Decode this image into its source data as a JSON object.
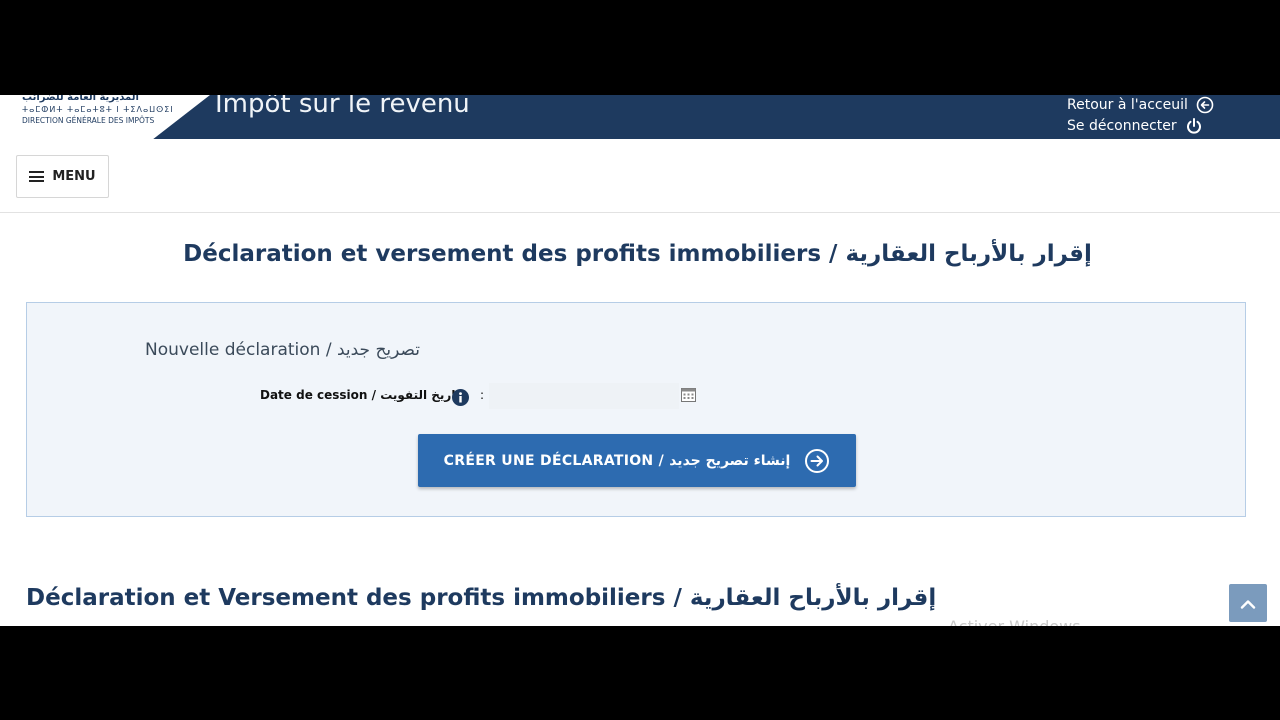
{
  "header": {
    "logo": {
      "arabic": "المديرية العامة للضرائب",
      "tifinagh": "ⵜⴰⵎⵀⵍⵜ ⵜⴰⵎⴰⵜⵓⵜ ⵏ ⵜⵉⴷⴰⵡⵙⵉⵏ",
      "french": "DIRECTION GÉNÉRALE DES IMPÔTS"
    },
    "app_title": "Impôt sur le revenu",
    "home_link": "Retour à l'acceuil",
    "logout_link": "Se déconnecter",
    "home_icon": "arrow-left-circle-icon",
    "logout_icon": "power-icon"
  },
  "menu": {
    "label": "MENU",
    "icon": "hamburger-icon"
  },
  "page_title": "Déclaration et versement des profits immobiliers / إقرار بالأرباح العقارية",
  "panel": {
    "heading": "Nouvelle déclaration / تصريح جديد",
    "date_label": "Date de cession / تاريخ التفويت",
    "info_icon": "info-icon",
    "colon": ":",
    "date_value": "",
    "calendar_icon": "calendar-icon",
    "create_button": "CRÉER UNE DÉCLARATION / إنشاء تصريح جديد",
    "create_icon": "arrow-right-circle-icon"
  },
  "section_title": "Déclaration et Versement des profits immobiliers / إقرار بالأرباح العقارية",
  "scroll_top_icon": "chevron-up-icon",
  "watermark": "Activer Windows",
  "colors": {
    "header_bg": "#1e3a5f",
    "title": "#1e3a5f",
    "button": "#2d6bb0",
    "panel_bg": "#f1f5fa",
    "panel_border": "#b6cde6",
    "scroll_top": "#7b9bbd"
  }
}
